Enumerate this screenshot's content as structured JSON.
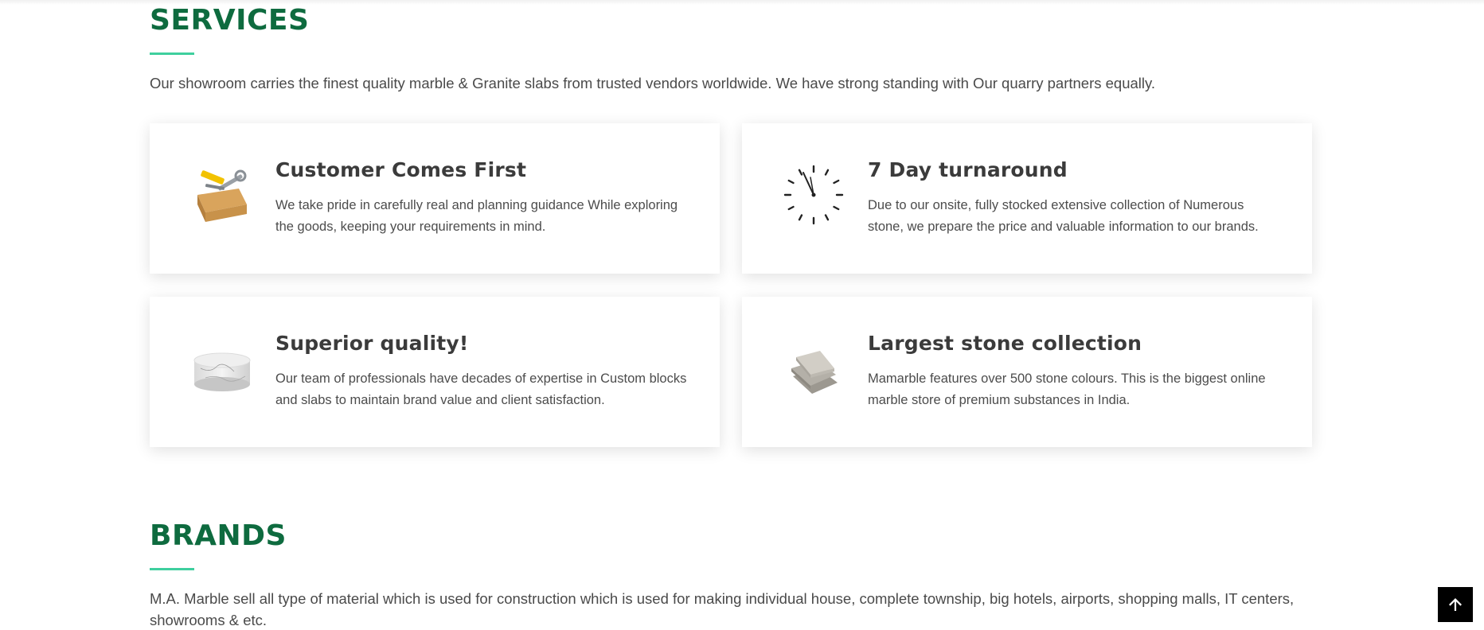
{
  "services": {
    "title": "SERVICES",
    "intro": "Our showroom carries the finest quality marble & Granite slabs from trusted vendors worldwide. We have strong standing with Our quarry partners equally.",
    "cards": [
      {
        "icon": "toolbox-icon",
        "title": "Customer Comes First",
        "text": "We take pride in carefully real and planning guidance While exploring the goods, keeping your requirements in mind."
      },
      {
        "icon": "clock-icon",
        "title": "7 Day turnaround",
        "text": "Due to our onsite, fully stocked extensive collection of Numerous stone, we prepare the price and valuable information to our brands."
      },
      {
        "icon": "marble-block-icon",
        "title": "Superior quality!",
        "text": "Our team of professionals have decades of expertise in Custom blocks and slabs to maintain brand value and client satisfaction."
      },
      {
        "icon": "stone-tiles-icon",
        "title": "Largest stone collection",
        "text": "Mamarble features over 500 stone colours. This is the biggest online marble store of premium substances in India."
      }
    ]
  },
  "brands": {
    "title": "BRANDS",
    "intro": "M.A. Marble sell all type of material which is used for construction which is used for making individual house, complete township, big hotels, airports, shopping malls, IT centers, showrooms & etc."
  },
  "back_to_top": {
    "icon": "arrow-up-icon"
  },
  "colors": {
    "heading": "#0e6b3f",
    "accent_bar": "#3fcf9e",
    "text": "#4a4a4a"
  }
}
